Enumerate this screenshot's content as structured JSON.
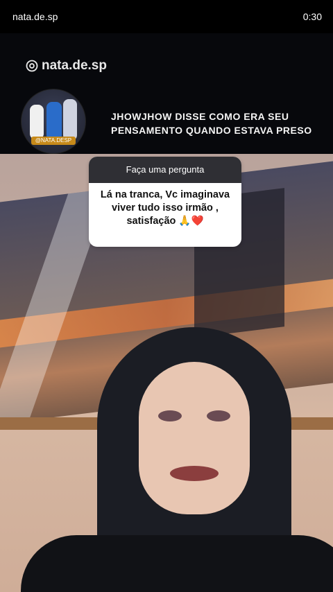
{
  "status_bar": {
    "left": "nata.de.sp",
    "right": "0:30"
  },
  "brand": {
    "handle": "nata.de.sp",
    "icon": "threads-icon"
  },
  "avatar": {
    "tag": "@NATA.DESP"
  },
  "headline": "JHOWJHOW DISSE COMO ERA SEU PENSAMENTO QUANDO ESTAVA PRESO",
  "question_box": {
    "header": "Faça uma pergunta",
    "question": "Lá na tranca, Vc imaginava viver tudo isso irmão , satisfação 🙏❤️"
  }
}
